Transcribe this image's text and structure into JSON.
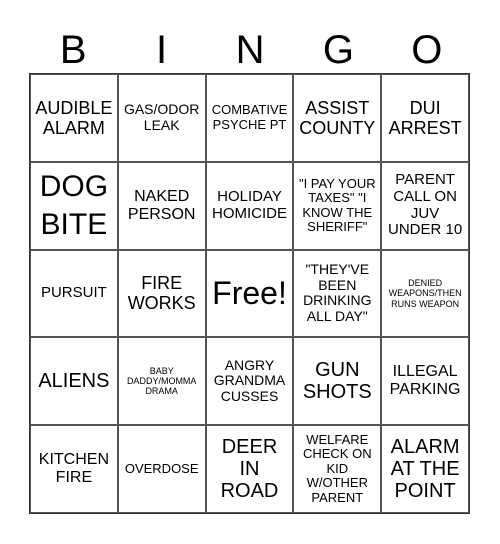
{
  "header": {
    "letters": [
      "B",
      "I",
      "N",
      "G",
      "O"
    ]
  },
  "cells": [
    "AUDIBLE ALARM",
    "GAS/ODOR LEAK",
    "COMBATIVE PSYCHE PT",
    "ASSIST COUNTY",
    "DUI ARREST",
    "DOG BITE",
    "NAKED PERSON",
    "HOLIDAY HOMICIDE",
    "\"I PAY YOUR TAXES\" \"I KNOW THE SHERIFF\"",
    "PARENT CALL ON JUV UNDER 10",
    "PURSUIT",
    "FIRE WORKS",
    "Free!",
    "\"THEY'VE BEEN DRINKING ALL DAY\"",
    "DENIED WEAPONS/THEN RUNS WEAPON",
    "ALIENS",
    "BABY DADDY/MOMMA DRAMA",
    "ANGRY GRANDMA CUSSES",
    "GUN SHOTS",
    "ILLEGAL PARKING",
    "KITCHEN FIRE",
    "OVERDOSE",
    "DEER IN ROAD",
    "WELFARE CHECK ON KID W/OTHER PARENT",
    "ALARM AT THE POINT"
  ]
}
